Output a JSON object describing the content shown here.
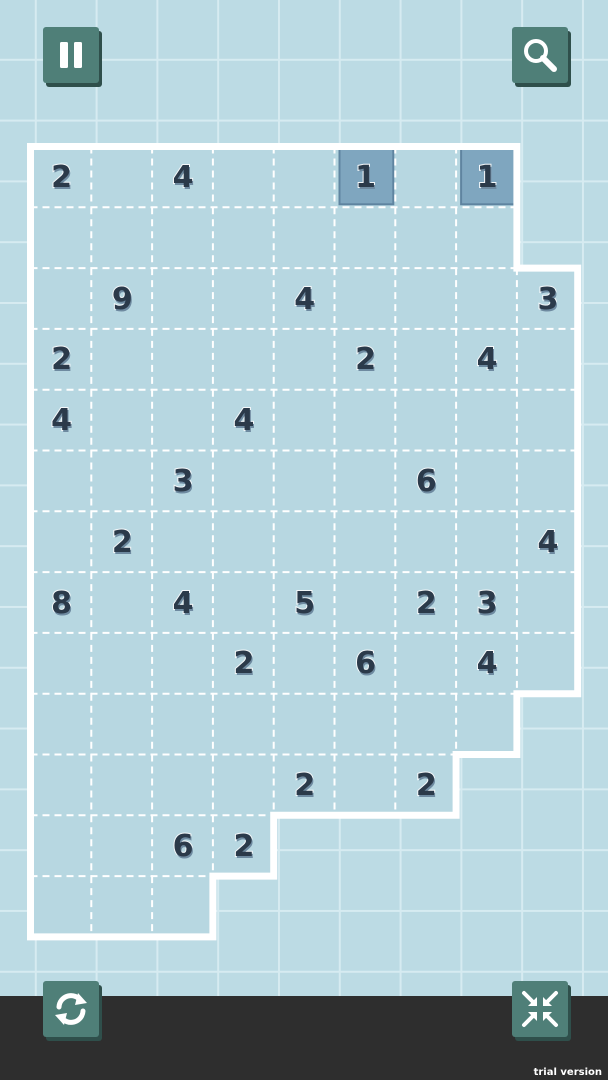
{
  "buttons": {
    "pause": {
      "icon": "pause-icon"
    },
    "zoom": {
      "icon": "magnifier-icon"
    },
    "restart": {
      "icon": "refresh-icon"
    },
    "collapse": {
      "icon": "collapse-arrows-icon"
    }
  },
  "colors": {
    "background": "#bcdbe4",
    "grid_line": "#d6ebf1",
    "board_fill": "#b7d7e1",
    "board_border": "#ffffff",
    "button": "#4f7f78",
    "selected_cell": "#7fa6bf",
    "number": "#2b3a4a",
    "bottom_bar": "#2e2e2e"
  },
  "board": {
    "cols": 9,
    "rows": 13,
    "row_lengths": [
      8,
      8,
      9,
      9,
      9,
      9,
      9,
      9,
      9,
      8,
      7,
      4,
      3
    ],
    "clues": [
      {
        "row": 0,
        "col": 0,
        "value": "2"
      },
      {
        "row": 0,
        "col": 2,
        "value": "4"
      },
      {
        "row": 0,
        "col": 5,
        "value": "1",
        "selected": true
      },
      {
        "row": 0,
        "col": 7,
        "value": "1",
        "selected": true
      },
      {
        "row": 2,
        "col": 1,
        "value": "9"
      },
      {
        "row": 2,
        "col": 4,
        "value": "4"
      },
      {
        "row": 2,
        "col": 8,
        "value": "3"
      },
      {
        "row": 3,
        "col": 0,
        "value": "2"
      },
      {
        "row": 3,
        "col": 5,
        "value": "2"
      },
      {
        "row": 3,
        "col": 7,
        "value": "4"
      },
      {
        "row": 4,
        "col": 0,
        "value": "4"
      },
      {
        "row": 4,
        "col": 3,
        "value": "4"
      },
      {
        "row": 5,
        "col": 2,
        "value": "3"
      },
      {
        "row": 5,
        "col": 6,
        "value": "6"
      },
      {
        "row": 6,
        "col": 1,
        "value": "2"
      },
      {
        "row": 6,
        "col": 8,
        "value": "4"
      },
      {
        "row": 7,
        "col": 0,
        "value": "8"
      },
      {
        "row": 7,
        "col": 2,
        "value": "4"
      },
      {
        "row": 7,
        "col": 4,
        "value": "5"
      },
      {
        "row": 7,
        "col": 6,
        "value": "2"
      },
      {
        "row": 7,
        "col": 7,
        "value": "3"
      },
      {
        "row": 8,
        "col": 3,
        "value": "2"
      },
      {
        "row": 8,
        "col": 5,
        "value": "6"
      },
      {
        "row": 8,
        "col": 7,
        "value": "4"
      },
      {
        "row": 10,
        "col": 4,
        "value": "2"
      },
      {
        "row": 10,
        "col": 6,
        "value": "2"
      },
      {
        "row": 11,
        "col": 2,
        "value": "6"
      },
      {
        "row": 11,
        "col": 3,
        "value": "2"
      }
    ]
  },
  "footer": {
    "trial_label": "trial version"
  }
}
